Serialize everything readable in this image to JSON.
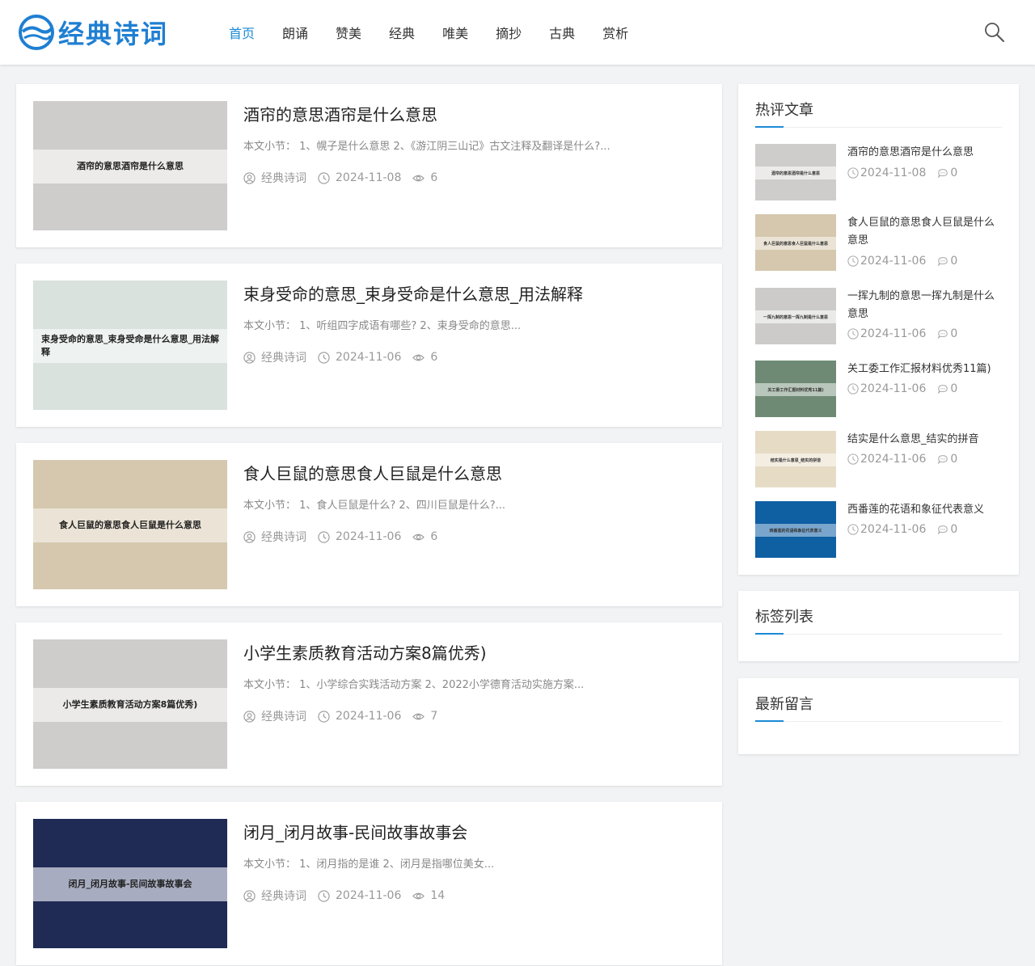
{
  "site": {
    "logo_text": "经典诗词",
    "brand_color": "#1f7fd2"
  },
  "nav": {
    "items": [
      {
        "label": "首页",
        "active": true
      },
      {
        "label": "朗诵"
      },
      {
        "label": "赞美"
      },
      {
        "label": "经典"
      },
      {
        "label": "唯美"
      },
      {
        "label": "摘抄"
      },
      {
        "label": "古典"
      },
      {
        "label": "赏析"
      }
    ],
    "active_color": "#1a8ad6",
    "search_icon": "search-icon"
  },
  "articles": [
    {
      "title": "酒帘的意思酒帘是什么意思",
      "thumb_caption": "酒帘的意思酒帘是什么意思",
      "excerpt": "本文小节： 1、幌子是什么意思 2、《游江阴三山记》古文注释及翻译是什么?...",
      "author": "经典诗词",
      "date": "2024-11-08",
      "views": "6",
      "thumb_bg": "#cfcdcb",
      "band_bg": "#ecebea"
    },
    {
      "title": "束身受命的意思_束身受命是什么意思_用法解释",
      "thumb_caption": "束身受命的意思_束身受命是什么意思_用法解释",
      "excerpt": "本文小节： 1、听组四字成语有哪些? 2、束身受命的意思...",
      "author": "经典诗词",
      "date": "2024-11-06",
      "views": "6",
      "thumb_bg": "#d9e2dd",
      "band_bg": "#eef2f0"
    },
    {
      "title": "食人巨鼠的意思食人巨鼠是什么意思",
      "thumb_caption": "食人巨鼠的意思食人巨鼠是什么意思",
      "excerpt": "本文小节： 1、食人巨鼠是什么? 2、四川巨鼠是什么?...",
      "author": "经典诗词",
      "date": "2024-11-06",
      "views": "6",
      "thumb_bg": "#d5c8ae",
      "band_bg": "#ebe4d6"
    },
    {
      "title": "小学生素质教育活动方案8篇优秀)",
      "thumb_caption": "小学生素质教育活动方案8篇优秀)",
      "excerpt": "本文小节： 1、小学综合实践活动方案 2、2022小学德育活动实施方案...",
      "author": "经典诗词",
      "date": "2024-11-06",
      "views": "7",
      "thumb_bg": "#cecdcb",
      "band_bg": "#ebeae9"
    },
    {
      "title": "闭月_闭月故事-民间故事故事会",
      "thumb_caption": "闭月_闭月故事-民间故事故事会",
      "excerpt": "本文小节： 1、闭月指的是谁 2、闭月是指哪位美女...",
      "author": "经典诗词",
      "date": "2024-11-06",
      "views": "14",
      "thumb_bg": "#1f2a55",
      "band_bg": "#a8acc0"
    }
  ],
  "sidebar": {
    "hot": {
      "title": "热评文章",
      "items": [
        {
          "title": "酒帘的意思酒帘是什么意思",
          "thumb_caption": "酒帘的意思酒帘是什么意思",
          "date": "2024-11-08",
          "comments": "0",
          "thumb_bg": "#cfcdcb",
          "band_bg": "#ecebea"
        },
        {
          "title": "食人巨鼠的意思食人巨鼠是什么意思",
          "thumb_caption": "食人巨鼠的意思食人巨鼠是什么意思",
          "date": "2024-11-06",
          "comments": "0",
          "thumb_bg": "#d5c8ae",
          "band_bg": "#ebe4d6"
        },
        {
          "title": "一挥九制的意思一挥九制是什么意思",
          "thumb_caption": "一挥九制的意思一挥九制是什么意思",
          "date": "2024-11-06",
          "comments": "0",
          "thumb_bg": "#cccbc9",
          "band_bg": "#eaeae9"
        },
        {
          "title": "关工委工作汇报材料优秀11篇)",
          "thumb_caption": "关工委工作汇报材料优秀11篇)",
          "date": "2024-11-06",
          "comments": "0",
          "thumb_bg": "#6f8a74",
          "band_bg": "#b8c6bb"
        },
        {
          "title": "结实是什么意思_结实的拼音",
          "thumb_caption": "结实是什么意思_结实的拼音",
          "date": "2024-11-06",
          "comments": "0",
          "thumb_bg": "#e6dcc6",
          "band_bg": "#f3ede2"
        },
        {
          "title": "西番莲的花语和象征代表意义",
          "thumb_caption": "西番莲的花语和象征代表意义",
          "date": "2024-11-06",
          "comments": "0",
          "thumb_bg": "#0f5fa3",
          "band_bg": "#7aa6cd"
        }
      ]
    },
    "tags": {
      "title": "标签列表"
    },
    "comments": {
      "title": "最新留言"
    }
  }
}
